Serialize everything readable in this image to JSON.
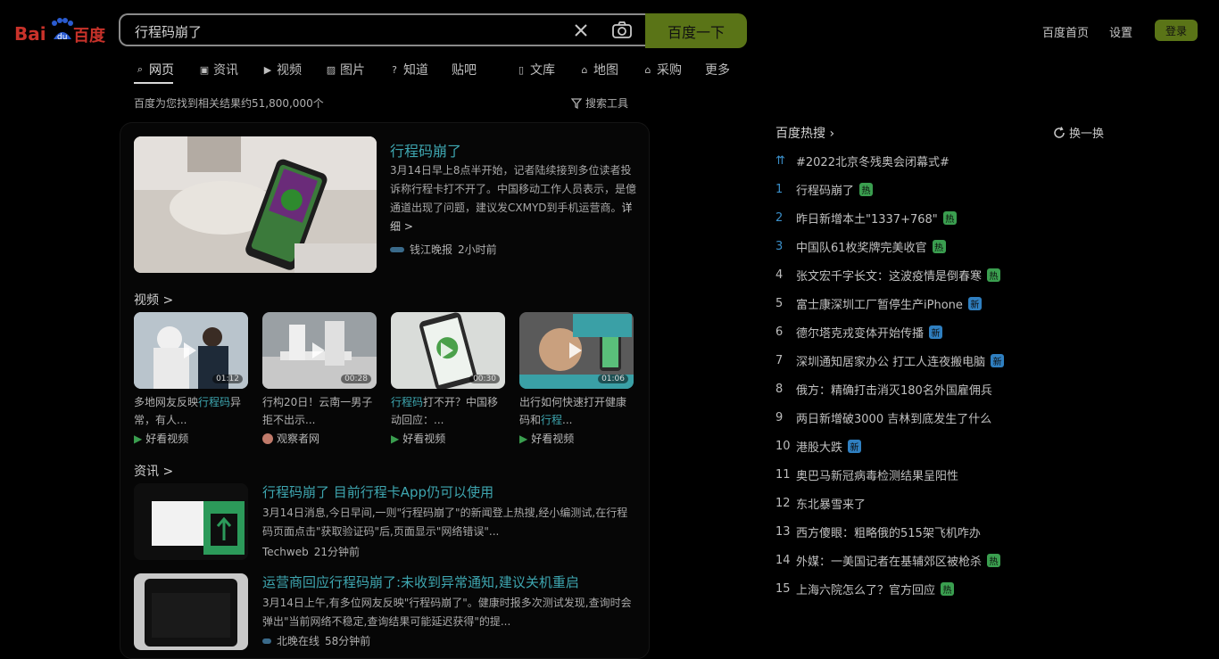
{
  "header": {
    "logo_text_left": "Bai",
    "logo_text_right": "百度",
    "query": "行程码崩了",
    "search_button": "百度一下",
    "links": [
      "百度首页",
      "设置"
    ],
    "login_button": "登录"
  },
  "tabs": [
    "网页",
    "资讯",
    "视频",
    "图片",
    "知道",
    "贴吧",
    "文库",
    "地图",
    "采购",
    "更多"
  ],
  "result_count": "百度为您找到相关结果约51,800,000个",
  "search_tools": "搜索工具",
  "lead": {
    "title": "行程码崩了",
    "text": "3月14日早上8点半开始，记者陆续接到多位读者投诉称行程卡打不开了。中国移动工作人员表示，是億通道出现了问题，建议发CXMYD到手机运营商。",
    "more": "详细 >",
    "source": "钱江晚报",
    "time": "2小时前"
  },
  "video_section": "视频 >",
  "videos": [
    {
      "title_pre": "多地网友反映",
      "title_hl": "行程码",
      "title_post": "异常，有人...",
      "duration": "01:12",
      "source": "好看视频"
    },
    {
      "title_pre": "行构20日！云南一男子拒不出示",
      "title_hl": "",
      "title_post": "...",
      "duration": "00:28",
      "source": "观察者网"
    },
    {
      "title_pre": "",
      "title_hl": "行程码",
      "title_post": "打不开？中国移动回应：...",
      "duration": "00:30",
      "source": "好看视频"
    },
    {
      "title_pre": "出行如何快速打开健康码和",
      "title_hl": "行程",
      "title_post": "...",
      "duration": "01:06",
      "source": "好看视频"
    }
  ],
  "news_section": "资讯 >",
  "news": [
    {
      "title": "行程码崩了 目前行程卡App仍可以使用",
      "text": "3月14日消息,今日早间,一则\"行程码崩了\"的新闻登上热搜,经小编测试,在行程码页面点击\"获取验证码\"后,页面显示\"网络错误\"...",
      "source": "Techweb",
      "time": "21分钟前"
    },
    {
      "title": "运营商回应行程码崩了:未收到异常通知,建议关机重启",
      "text": "3月14日上午,有多位网友反映\"行程码崩了\"。健康时报多次测试发现,查询时会弹出\"当前网络不稳定,查询结果可能延迟获得\"的提...",
      "source": "北晚在线",
      "time": "58分钟前"
    }
  ],
  "hot": {
    "title": "百度热搜",
    "refresh": "换一换",
    "items": [
      {
        "num": "⇈",
        "text": "#2022北京冬残奥会闭幕式#",
        "badge": ""
      },
      {
        "num": "1",
        "text": "行程码崩了",
        "badge": "热"
      },
      {
        "num": "2",
        "text": "昨日新增本土\"1337+768\"",
        "badge": "热"
      },
      {
        "num": "3",
        "text": "中国队61枚奖牌完美收官",
        "badge": "热"
      },
      {
        "num": "4",
        "text": "张文宏千字长文：这波疫情是倒春寒",
        "badge": "热"
      },
      {
        "num": "5",
        "text": "富士康深圳工厂暂停生产iPhone",
        "badge": "新"
      },
      {
        "num": "6",
        "text": "德尔塔克戎变体开始传播",
        "badge": "新"
      },
      {
        "num": "7",
        "text": "深圳通知居家办公 打工人连夜搬电脑",
        "badge": "新"
      },
      {
        "num": "8",
        "text": "俄方：精确打击消灭180名外国雇佣兵",
        "badge": ""
      },
      {
        "num": "9",
        "text": "两日新增破3000 吉林到底发生了什么",
        "badge": ""
      },
      {
        "num": "10",
        "text": "港股大跌",
        "badge": "新"
      },
      {
        "num": "11",
        "text": "奥巴马新冠病毒检测结果呈阳性",
        "badge": ""
      },
      {
        "num": "12",
        "text": "东北暴雪来了",
        "badge": ""
      },
      {
        "num": "13",
        "text": "西方傻眼：粗略俄的515架飞机咋办",
        "badge": ""
      },
      {
        "num": "14",
        "text": "外媒：一美国记者在基辅郊区被枪杀",
        "badge": "热"
      },
      {
        "num": "15",
        "text": "上海六院怎么了？官方回应",
        "badge": "热"
      }
    ]
  },
  "colors": {
    "accent": "#5a7417",
    "link": "#3ea6b0",
    "hot_badge": "#3a9e4f",
    "new_badge": "#2f7fc0"
  }
}
